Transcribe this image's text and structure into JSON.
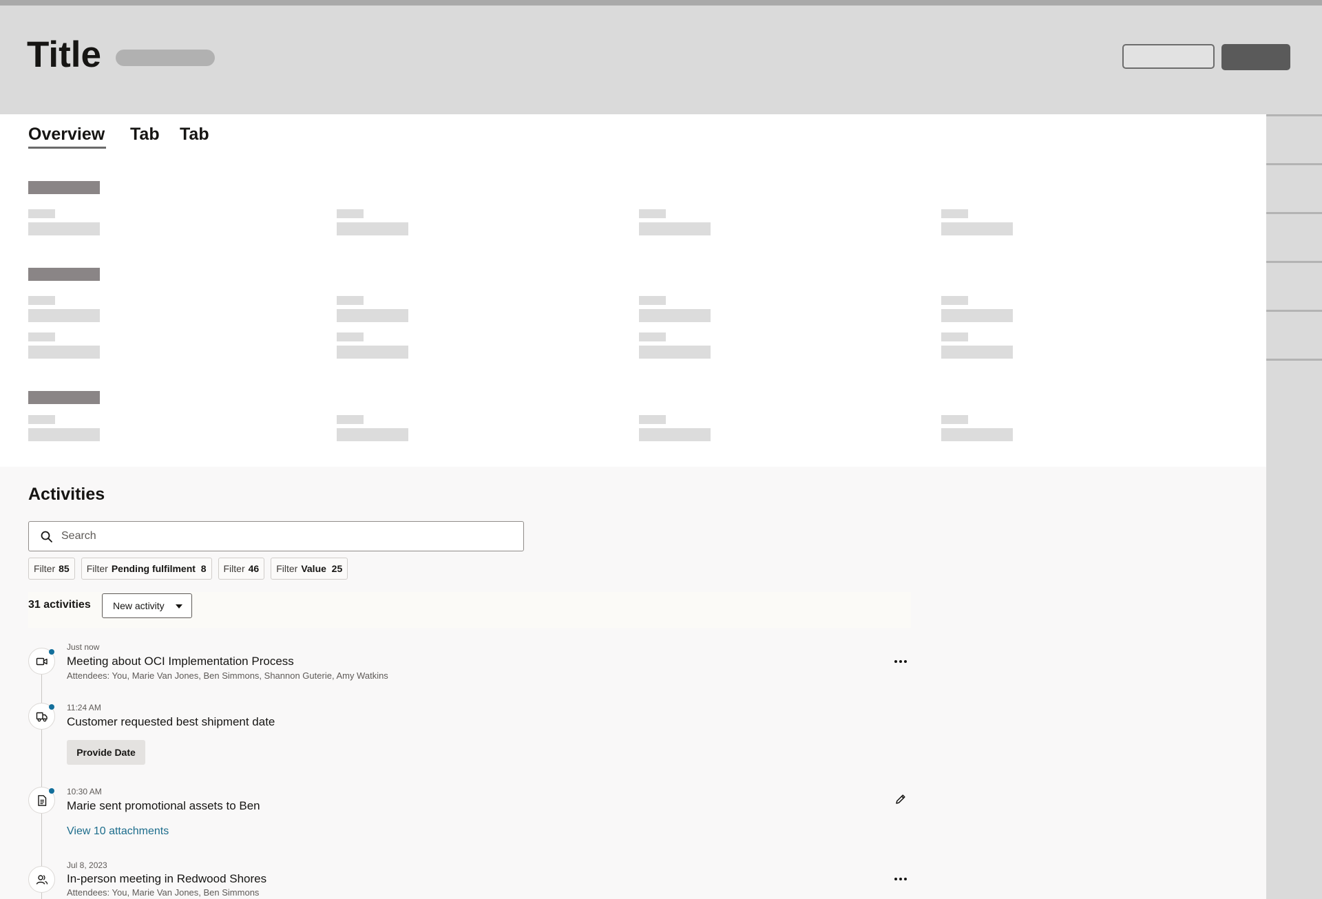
{
  "header": {
    "title": "Title"
  },
  "tabs": [
    {
      "label": "Overview",
      "selected": true
    },
    {
      "label": "Tab",
      "selected": false
    },
    {
      "label": "Tab",
      "selected": false
    }
  ],
  "activities": {
    "title": "Activities",
    "search": {
      "placeholder": "Search",
      "value": ""
    },
    "filters": [
      {
        "label": "Filter",
        "value": "85"
      },
      {
        "label": "Filter",
        "value": "Pending fulfilment  8"
      },
      {
        "label": "Filter",
        "value": "46"
      },
      {
        "label": "Filter",
        "value": "Value  25"
      }
    ],
    "count_label": "31 activities",
    "new_activity_label": "New activity",
    "items": [
      {
        "icon": "video-camera-icon",
        "unread": true,
        "timestamp": "Just now",
        "title": "Meeting about OCI Implementation Process",
        "subtitle": "Attendees: You, Marie Van Jones, Ben Simmons, Shannon Guterie, Amy Watkins",
        "menu_icon": "more-options-icon"
      },
      {
        "icon": "truck-icon",
        "unread": true,
        "timestamp": "11:24 AM",
        "title": "Customer requested best shipment date",
        "action_label": "Provide Date"
      },
      {
        "icon": "document-icon",
        "unread": true,
        "timestamp": "10:30 AM",
        "title": "Marie sent promotional assets to Ben",
        "link_label": "View 10 attachments",
        "menu_icon": "pencil-icon"
      },
      {
        "icon": "people-icon",
        "unread": false,
        "timestamp": "Jul 8, 2023",
        "title": "In-person meeting in Redwood Shores",
        "subtitle": "Attendees: You, Marie Van Jones, Ben Simmons",
        "menu_icon": "more-options-icon"
      }
    ]
  },
  "colors": {
    "header_bg": "#dadada",
    "accent_dot": "#136f9b",
    "link": "#1d6d8c",
    "skeleton": "#dcdcdc",
    "section_bar": "#8a8586"
  }
}
